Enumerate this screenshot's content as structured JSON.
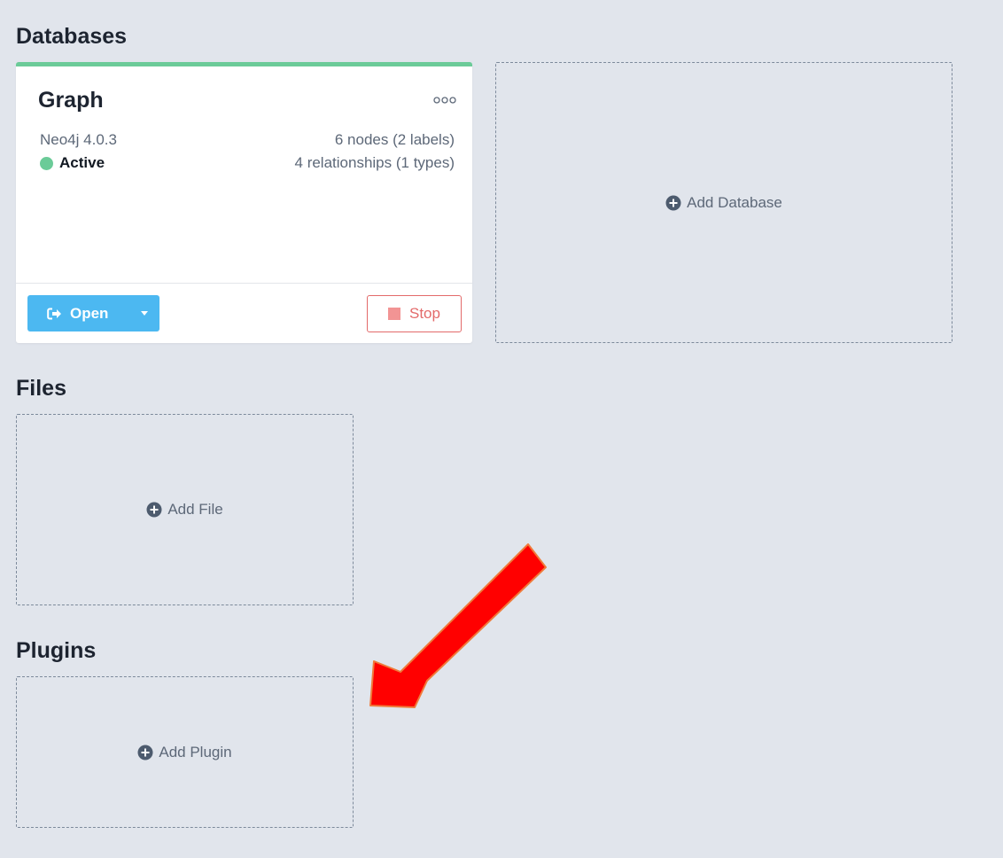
{
  "sections": {
    "databases": "Databases",
    "files": "Files",
    "plugins": "Plugins"
  },
  "database": {
    "name": "Graph",
    "version": "Neo4j 4.0.3",
    "status": "Active",
    "nodes": "6 nodes (2 labels)",
    "relationships": "4 relationships (1 types)",
    "open_label": "Open",
    "stop_label": "Stop"
  },
  "add": {
    "database": "Add Database",
    "file": "Add File",
    "plugin": "Add Plugin"
  },
  "icons": {
    "more": "more-dots-icon",
    "open": "open-external-icon",
    "dropdown": "chevron-down-icon",
    "stop": "stop-square-icon",
    "plus": "plus-circle-icon",
    "annotation": "red-arrow-icon"
  },
  "colors": {
    "active": "#6bcb98",
    "primary": "#4cb8f1",
    "danger": "#e36a6a",
    "annotation": "#ff0000"
  }
}
